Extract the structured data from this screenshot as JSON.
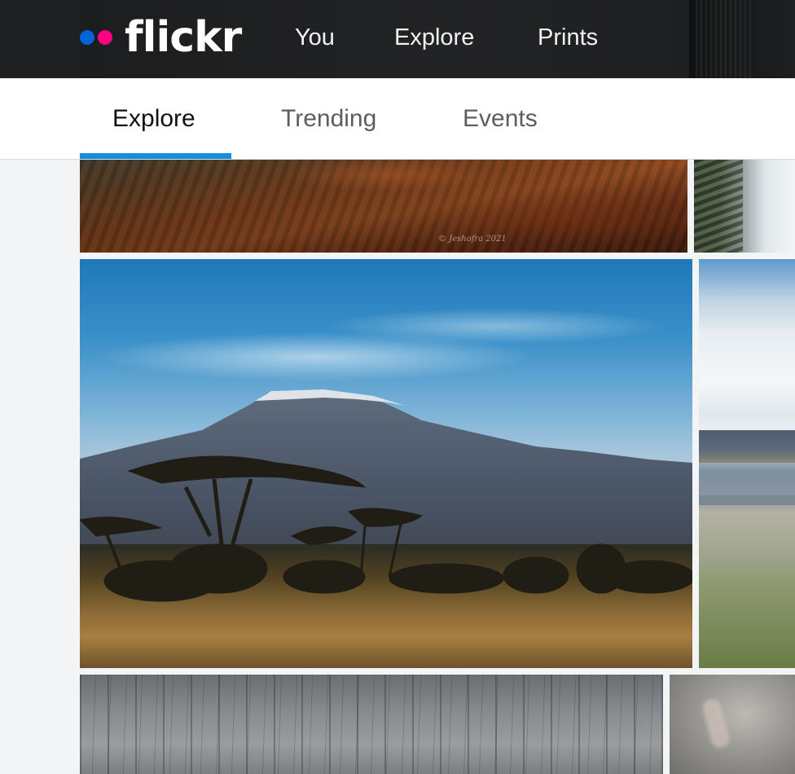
{
  "brand": {
    "name": "flickr",
    "colors": {
      "blue": "#0063dc",
      "pink": "#ff0084"
    }
  },
  "topnav": {
    "links": [
      {
        "label": "You"
      },
      {
        "label": "Explore"
      },
      {
        "label": "Prints"
      }
    ]
  },
  "subnav": {
    "tabs": [
      {
        "label": "Explore",
        "active": true
      },
      {
        "label": "Trending",
        "active": false
      },
      {
        "label": "Events",
        "active": false
      }
    ],
    "accent": "#128fdc"
  },
  "photos": {
    "mountain_red": {
      "watermark": "© Jeshofra 2021"
    }
  }
}
